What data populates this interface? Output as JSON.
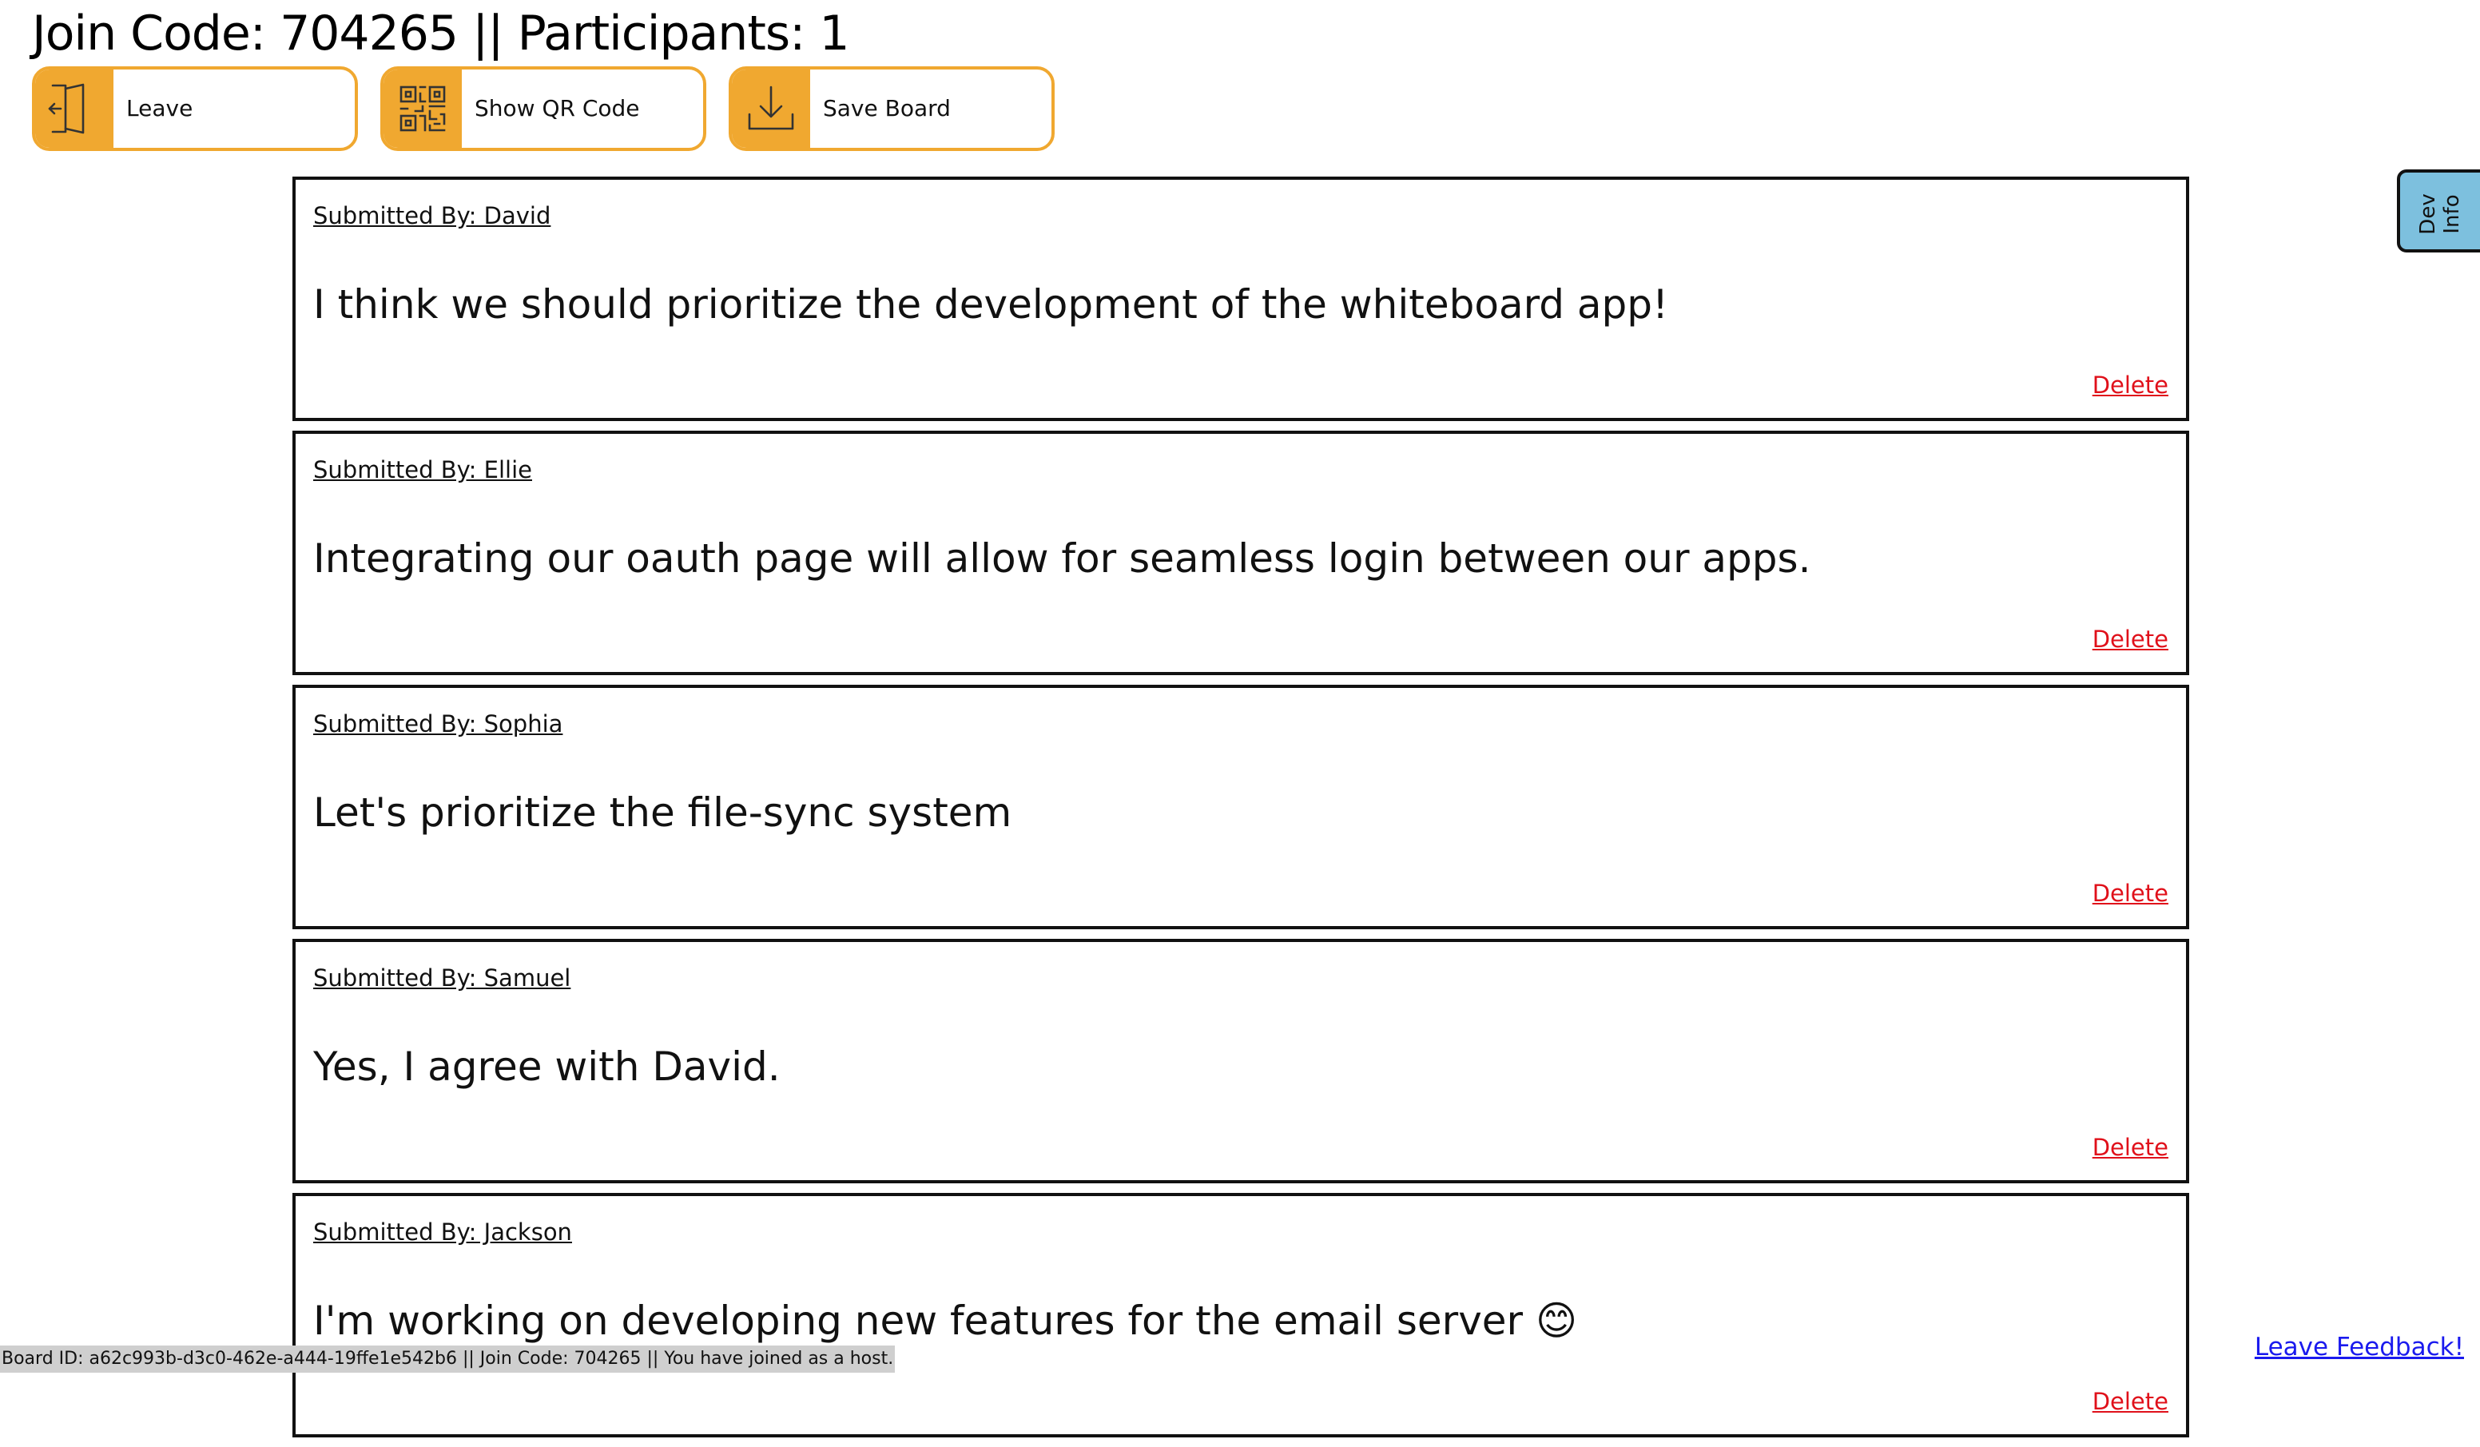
{
  "header": {
    "title": "Join Code: 704265 || Participants: 1"
  },
  "toolbar": {
    "leave_label": "Leave",
    "leave_icon": "exit-door-icon",
    "qr_label": "Show QR Code",
    "qr_icon": "qr-code-icon",
    "save_label": "Save Board",
    "save_icon": "download-icon",
    "accent_color": "#f0a830"
  },
  "posts": [
    {
      "author": "Submitted By: David",
      "message": "I think we should prioritize the development of the whiteboard app!",
      "delete_label": "Delete"
    },
    {
      "author": "Submitted By: Ellie",
      "message": "Integrating our oauth page will allow for seamless login between our apps.",
      "delete_label": "Delete"
    },
    {
      "author": "Submitted By: Sophia",
      "message": "Let's prioritize the file-sync system",
      "delete_label": "Delete"
    },
    {
      "author": "Submitted By: Samuel",
      "message": "Yes, I agree with David.",
      "delete_label": "Delete"
    },
    {
      "author": "Submitted By: Jackson",
      "message": "I'm working on developing new features for the email server 😊",
      "delete_label": "Delete"
    }
  ],
  "dev_tab": {
    "label": "Dev\nInfo",
    "color": "#7dc0de"
  },
  "status_bar": {
    "text": "Board ID: a62c993b-d3c0-462e-a444-19ffe1e542b6 || Join Code: 704265 || You have joined as a host."
  },
  "feedback": {
    "label": "Leave Feedback!"
  }
}
